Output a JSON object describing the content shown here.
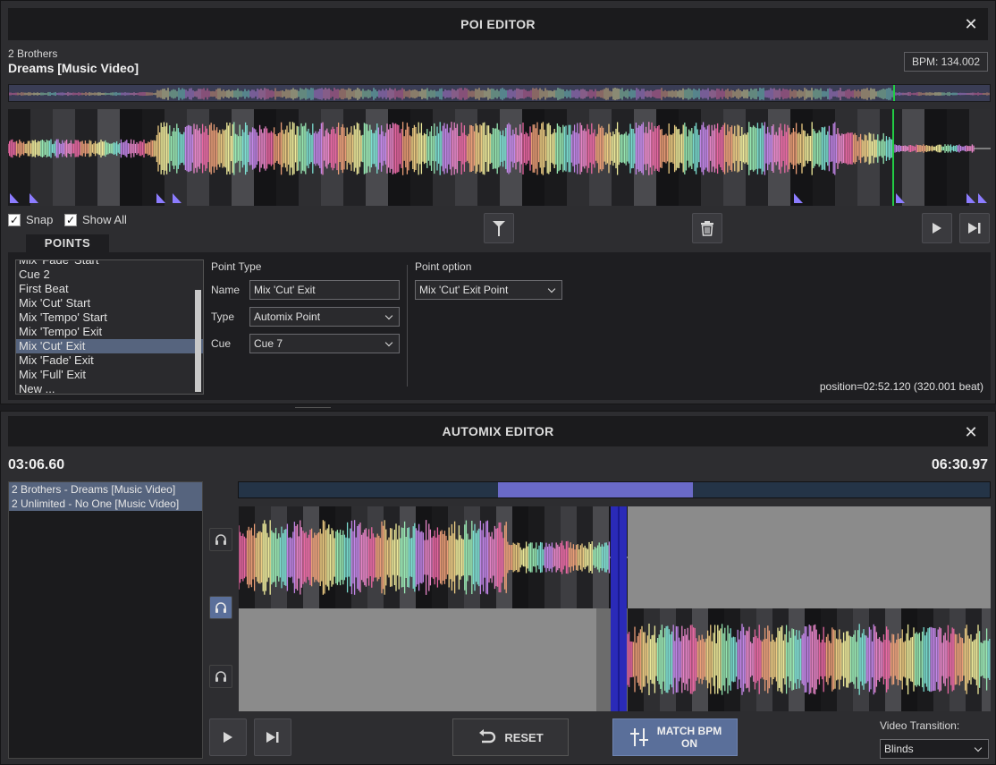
{
  "poi_editor": {
    "title": "POI EDITOR",
    "artist": "2 Brothers",
    "song_title": "Dreams [Music Video]",
    "bpm": "BPM: 134.002",
    "snap_label": "Snap",
    "snap_checked": true,
    "show_all_label": "Show All",
    "show_all_checked": true,
    "points_tab": "POINTS",
    "points_list": [
      "Mix 'Fade' Start",
      "Cue 2",
      "First Beat",
      "Mix 'Cut' Start",
      "Mix 'Tempo' Start",
      "Mix 'Tempo' Exit",
      "Mix 'Cut' Exit",
      "Mix 'Fade' Exit",
      "Mix 'Full' Exit",
      "New ..."
    ],
    "selected_point": "Mix 'Cut' Exit",
    "point_type_header": "Point Type",
    "name_label": "Name",
    "name_value": "Mix 'Cut' Exit",
    "type_label": "Type",
    "type_value": "Automix Point",
    "cue_label": "Cue",
    "cue_value": "Cue 7",
    "point_option_header": "Point option",
    "point_option_value": "Mix 'Cut' Exit Point",
    "position": "position=02:52.120 (320.001 beat)",
    "icons": [
      "close-icon",
      "marker-icon",
      "trash-icon",
      "play-icon",
      "skip-end-icon"
    ]
  },
  "automix_editor": {
    "title": "AUTOMIX EDITOR",
    "time_left": "03:06.60",
    "time_right": "06:30.97",
    "tracks": [
      "2 Brothers - Dreams [Music Video]",
      "2 Unlimited - No One [Music Video]"
    ],
    "reset_label": "RESET",
    "match_bpm_label_1": "MATCH BPM",
    "match_bpm_label_2": "ON",
    "video_transition_label": "Video Transition:",
    "video_transition_value": "Blinds",
    "progress_range": [
      0.345,
      0.605
    ],
    "icons": [
      "close-icon",
      "headphones-icon",
      "play-icon",
      "skip-end-icon",
      "undo-icon",
      "sliders-icon"
    ]
  },
  "colors": {
    "accent_blue": "#5a6f9a",
    "marker_purple": "#8c7cff",
    "playhead_green": "#22cc44"
  }
}
